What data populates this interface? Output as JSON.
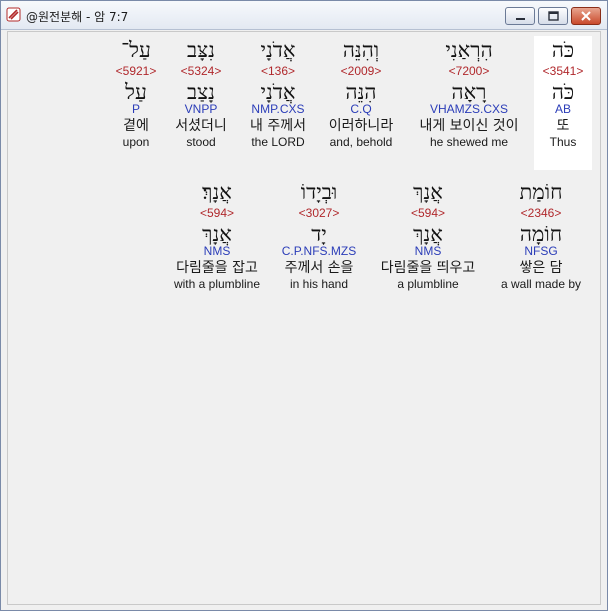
{
  "window": {
    "title": "@원전분해 - 암 7:7"
  },
  "row1": [
    {
      "heb": "עַל־",
      "strong": "<5921>",
      "lemma": "עַל",
      "parse": "P",
      "korean": "곁에",
      "english": "upon"
    },
    {
      "heb": "נִצָּב",
      "strong": "<5324>",
      "lemma": "נָצַב",
      "parse": "VNPP",
      "korean": "서셨더니",
      "english": "stood"
    },
    {
      "heb": "אֲדֹנָי",
      "strong": "<136>",
      "lemma": "אֲדֹנָי",
      "parse": "NMP.CXS",
      "korean": "내 주께서",
      "english": "the LORD"
    },
    {
      "heb": "וְהִנֵּה",
      "strong": "<2009>",
      "lemma": "הִנֵּה",
      "parse": "C.Q",
      "korean": "이러하니라",
      "english": "and, behold"
    },
    {
      "heb": "הִרְאַנִי",
      "strong": "<7200>",
      "lemma": "רָאָה",
      "parse": "VHAMZS.CXS",
      "korean": "내게 보이신 것이",
      "english": "he shewed me"
    },
    {
      "heb": "כֹּה",
      "strong": "<3541>",
      "lemma": "כֹּה",
      "parse": "AB",
      "korean": "또",
      "english": "Thus"
    }
  ],
  "row2": [
    {
      "heb": "אֲנָךְ׃",
      "strong": "<594>",
      "lemma": "אֲנָךְ",
      "parse": "NMS",
      "korean": "다림줄을 잡고",
      "english": "with a plumbline"
    },
    {
      "heb": "וּבְיָדוֹ",
      "strong": "<3027>",
      "lemma": "יָד",
      "parse": "C.P.NFS.MZS",
      "korean": "주께서 손을",
      "english": "in his hand"
    },
    {
      "heb": "אֲנָךְ",
      "strong": "<594>",
      "lemma": "אֲנָךְ",
      "parse": "NMS",
      "korean": "다림줄을 띄우고",
      "english": "a plumbline"
    },
    {
      "heb": "חוֹמַת",
      "strong": "<2346>",
      "lemma": "חוֹמָה",
      "parse": "NFSG",
      "korean": "쌓은 담",
      "english": "a wall made by"
    }
  ],
  "colors": {
    "strong": "#b0282c",
    "parse": "#2b3db8",
    "highlight": "#ffffff"
  }
}
